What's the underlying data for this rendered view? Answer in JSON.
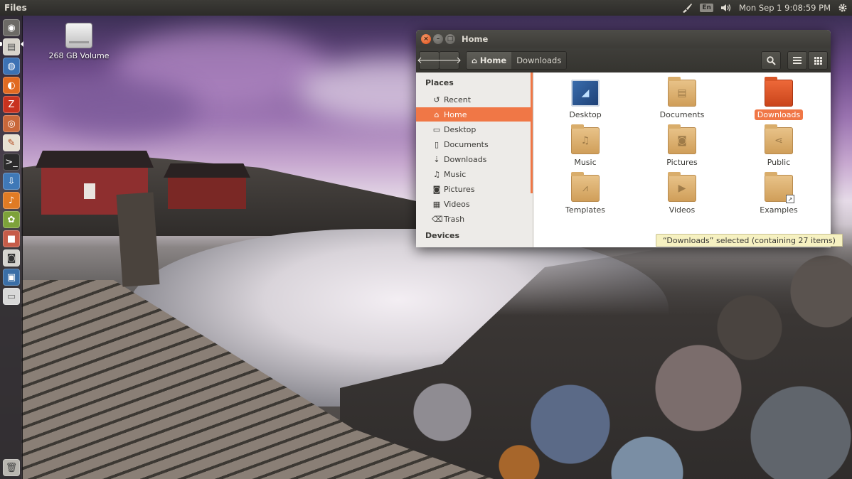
{
  "top_panel": {
    "app_title": "Files",
    "keyboard_layout": "En",
    "clock": "Mon Sep  1  9:08:59 PM"
  },
  "desktop": {
    "volume_label": "268 GB Volume"
  },
  "window": {
    "title": "Home",
    "breadcrumbs": {
      "home_label": "Home",
      "downloads_label": "Downloads"
    },
    "sidebar": {
      "places_heading": "Places",
      "devices_heading": "Devices",
      "items": [
        {
          "label": "Recent",
          "icon": "recent-icon"
        },
        {
          "label": "Home",
          "icon": "home-icon"
        },
        {
          "label": "Desktop",
          "icon": "desktop-icon"
        },
        {
          "label": "Documents",
          "icon": "documents-icon"
        },
        {
          "label": "Downloads",
          "icon": "downloads-icon"
        },
        {
          "label": "Music",
          "icon": "music-icon"
        },
        {
          "label": "Pictures",
          "icon": "pictures-icon"
        },
        {
          "label": "Videos",
          "icon": "videos-icon"
        },
        {
          "label": "Trash",
          "icon": "trash-icon"
        }
      ],
      "selected_item": "Home"
    },
    "folders": [
      {
        "label": "Desktop",
        "icon": "desktop-folder-icon"
      },
      {
        "label": "Documents",
        "icon": "documents-folder-icon"
      },
      {
        "label": "Downloads",
        "icon": "downloads-folder-icon",
        "selected": true
      },
      {
        "label": "Music",
        "icon": "music-folder-icon"
      },
      {
        "label": "Pictures",
        "icon": "pictures-folder-icon"
      },
      {
        "label": "Public",
        "icon": "public-folder-icon"
      },
      {
        "label": "Templates",
        "icon": "templates-folder-icon"
      },
      {
        "label": "Videos",
        "icon": "videos-folder-icon"
      },
      {
        "label": "Examples",
        "icon": "examples-folder-icon"
      }
    ],
    "status": "“Downloads” selected  (containing 27 items)"
  },
  "colors": {
    "accent": "#f07746",
    "panel": "#3c3b37",
    "folder": "#d9ad6b",
    "status_bg": "#f6f1c1"
  }
}
